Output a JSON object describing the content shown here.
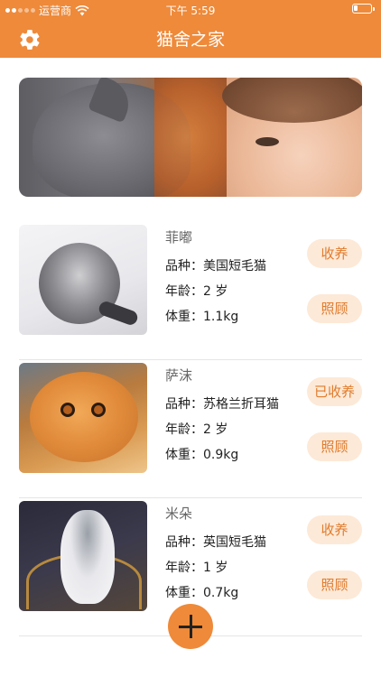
{
  "status_bar": {
    "carrier": "运营商",
    "time": "下午 5:59",
    "battery_level": 0.25
  },
  "nav": {
    "title": "猫舍之家",
    "settings_icon": "gear-icon"
  },
  "banner": {
    "image": "cat-and-girl-photo"
  },
  "cats": [
    {
      "name": "菲嘟",
      "breed": "品种：美国短毛猫",
      "age": "年龄：2 岁",
      "weight": "体重：1.1kg",
      "adopt_label": "收养",
      "care_label": "照顾",
      "photo": "silver-tabby-cat-photo"
    },
    {
      "name": "萨沫",
      "breed": "品种：苏格兰折耳猫",
      "age": "年龄：2 岁",
      "weight": "体重：0.9kg",
      "adopt_label": "已收养",
      "care_label": "照顾",
      "photo": "orange-fold-cat-photo"
    },
    {
      "name": "米朵",
      "breed": "品种：英国短毛猫",
      "age": "年龄：1 岁",
      "weight": "体重：0.7kg",
      "adopt_label": "收养",
      "care_label": "照顾",
      "photo": "white-kitten-photo"
    }
  ],
  "fab": {
    "icon": "plus-icon"
  },
  "colors": {
    "accent": "#ee8a3a",
    "pill_bg": "#fde9d7",
    "pill_text": "#e07b2c"
  }
}
